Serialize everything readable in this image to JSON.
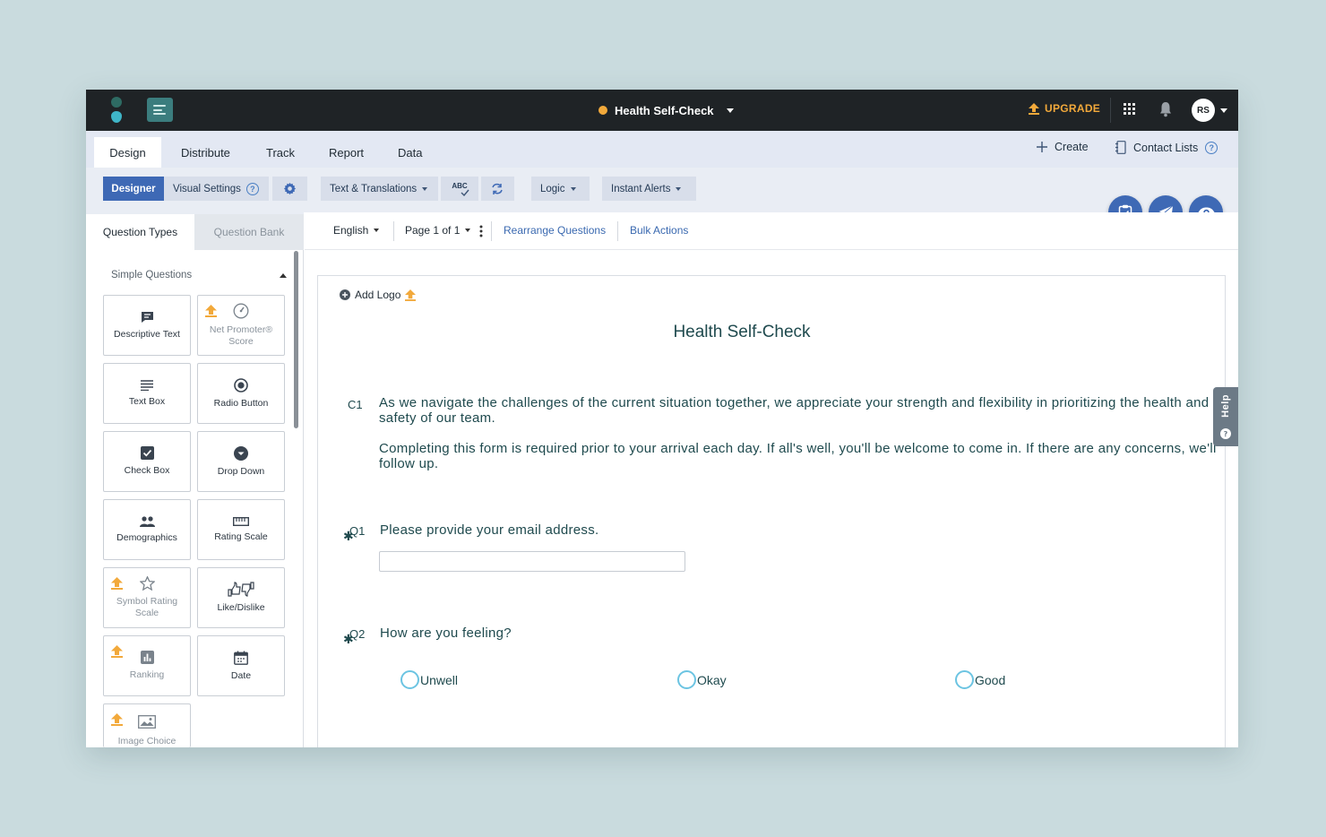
{
  "topbar": {
    "survey_title": "Health Self-Check",
    "upgrade_label": "UPGRADE",
    "avatar_initials": "RS",
    "accent_color": "#f2a93b"
  },
  "nav": {
    "tabs": [
      {
        "label": "Design",
        "active": true
      },
      {
        "label": "Distribute"
      },
      {
        "label": "Track"
      },
      {
        "label": "Report"
      },
      {
        "label": "Data"
      }
    ],
    "create_label": "Create",
    "contact_lists_label": "Contact Lists"
  },
  "toolbar": {
    "designer_label": "Designer",
    "visual_settings_label": "Visual Settings",
    "text_translations_label": "Text & Translations",
    "spellcheck_label": "ABC",
    "logic_label": "Logic",
    "instant_alerts_label": "Instant Alerts"
  },
  "left_panel": {
    "tabs": [
      "Question Types",
      "Question Bank"
    ],
    "section_title": "Simple Questions",
    "question_types": [
      {
        "label": "Descriptive Text",
        "icon": "comment-icon",
        "locked": false
      },
      {
        "label": "Net Promoter® Score",
        "icon": "gauge-icon",
        "locked": true
      },
      {
        "label": "Text Box",
        "icon": "lines-icon",
        "locked": false
      },
      {
        "label": "Radio Button",
        "icon": "radio-icon",
        "locked": false
      },
      {
        "label": "Check Box",
        "icon": "checkbox-icon",
        "locked": false
      },
      {
        "label": "Drop Down",
        "icon": "dropdown-icon",
        "locked": false
      },
      {
        "label": "Demographics",
        "icon": "users-icon",
        "locked": false
      },
      {
        "label": "Rating Scale",
        "icon": "ruler-icon",
        "locked": false
      },
      {
        "label": "Symbol Rating Scale",
        "icon": "star-icon",
        "locked": true
      },
      {
        "label": "Like/Dislike",
        "icon": "thumbs-icon",
        "locked": false
      },
      {
        "label": "Ranking",
        "icon": "bar-chart-icon",
        "locked": true
      },
      {
        "label": "Date",
        "icon": "calendar-icon",
        "locked": false
      },
      {
        "label": "Image Choice",
        "icon": "image-icon",
        "locked": true
      }
    ]
  },
  "subbar": {
    "language": "English",
    "page": "Page 1 of 1",
    "rearrange_label": "Rearrange Questions",
    "bulk_label": "Bulk Actions"
  },
  "survey": {
    "add_logo_label": "Add Logo",
    "heading": "Health Self-Check",
    "intro_number": "C1",
    "intro_p1": "As we navigate the challenges of the current situation together, we appreciate your strength and flexibility in prioritizing the health and safety of our team.",
    "intro_p2": "Completing this form is required prior to your arrival each day. If all's well, you'll be welcome to come in. If there are any concerns, we'll follow up.",
    "q1_number": "Q1",
    "q1_text": "Please provide your email address.",
    "q1_value": "",
    "q2_number": "Q2",
    "q2_text": "How are you feeling?",
    "q2_options": [
      "Unwell",
      "Okay",
      "Good"
    ]
  },
  "help_tab_label": "Help"
}
